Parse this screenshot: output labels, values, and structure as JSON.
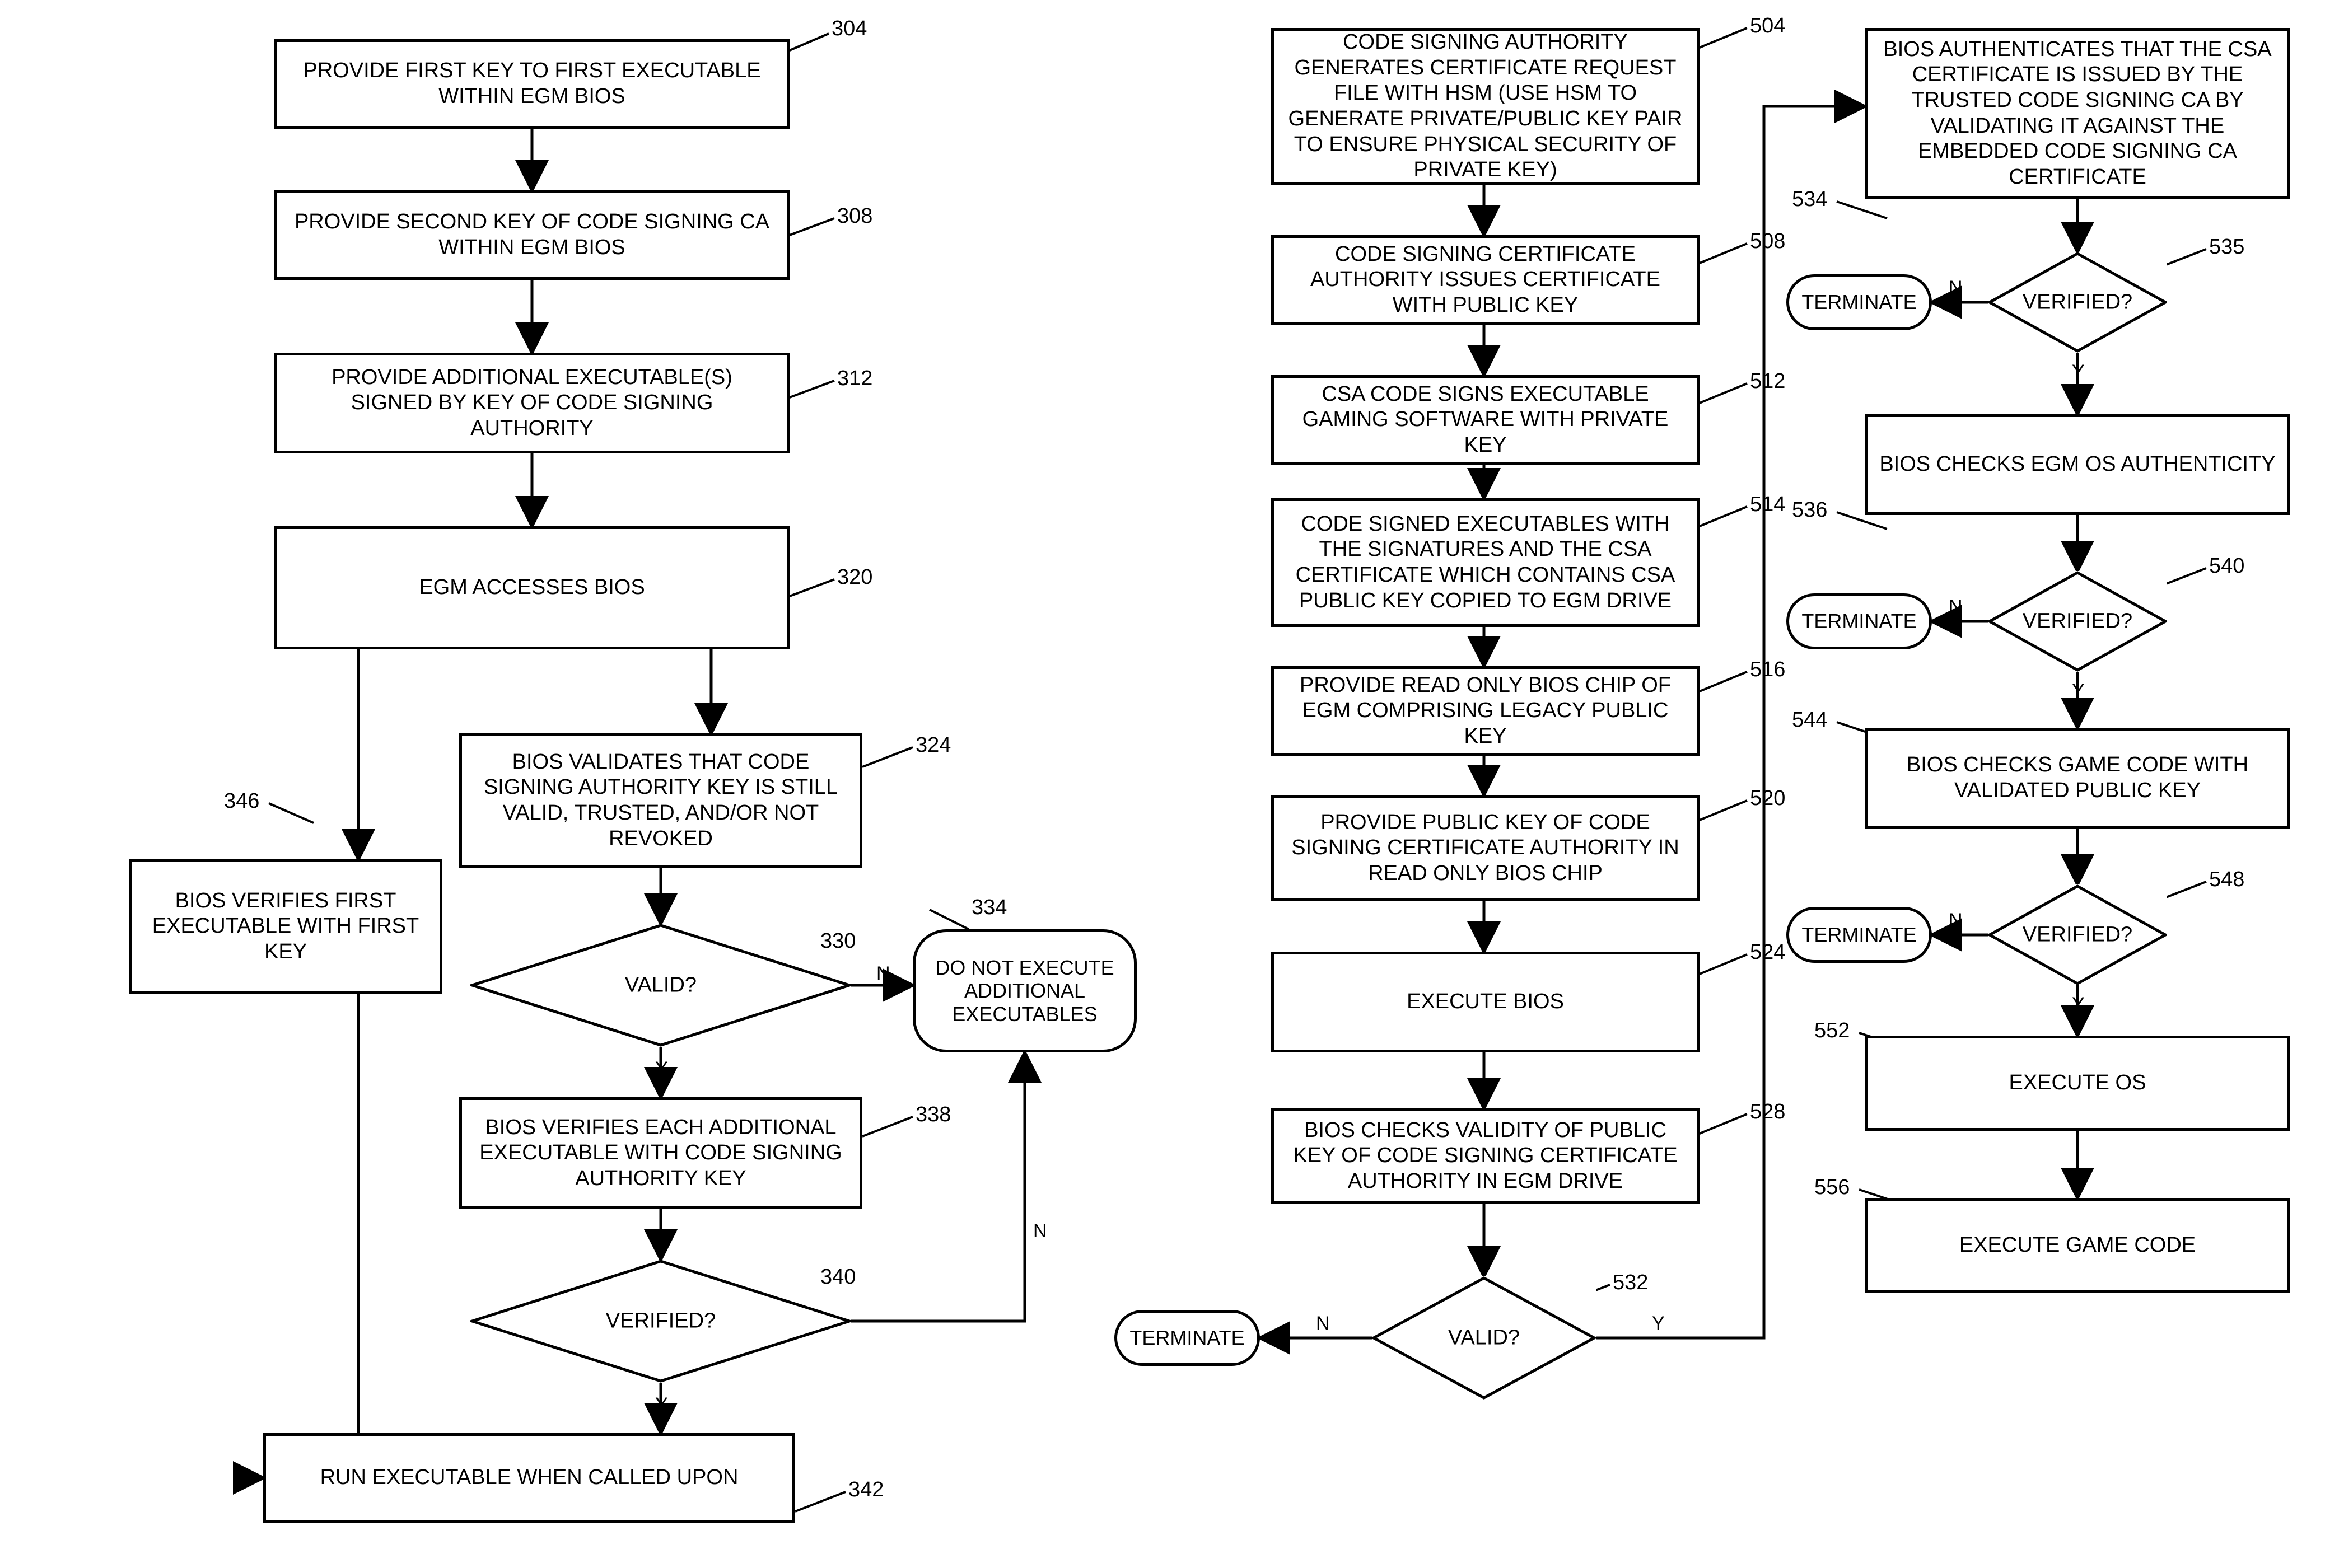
{
  "left": {
    "b304": "PROVIDE FIRST KEY TO FIRST EXECUTABLE WITHIN EGM BIOS",
    "b308": "PROVIDE SECOND KEY OF CODE SIGNING CA WITHIN EGM  BIOS",
    "b312": "PROVIDE ADDITIONAL EXECUTABLE(S) SIGNED BY KEY OF CODE SIGNING AUTHORITY",
    "b320": "EGM ACCESSES BIOS",
    "b324": "BIOS VALIDATES THAT CODE SIGNING AUTHORITY KEY IS STILL VALID, TRUSTED, AND/OR NOT REVOKED",
    "d330": "VALID?",
    "t334": "DO NOT EXECUTE ADDITIONAL EXECUTABLES",
    "b338": "BIOS VERIFIES EACH ADDITIONAL EXECUTABLE WITH CODE SIGNING AUTHORITY KEY",
    "d340": "VERIFIED?",
    "b342": "RUN EXECUTABLE WHEN CALLED UPON",
    "b346": "BIOS VERIFIES FIRST EXECUTABLE WITH FIRST KEY",
    "r304": "304",
    "r308": "308",
    "r312": "312",
    "r320": "320",
    "r324": "324",
    "r330": "330",
    "r334": "334",
    "r338": "338",
    "r340": "340",
    "r342": "342",
    "r346": "346"
  },
  "mid": {
    "b504": "CODE SIGNING AUTHORITY GENERATES CERTIFICATE REQUEST FILE WITH HSM (USE HSM TO GENERATE PRIVATE/PUBLIC KEY PAIR TO ENSURE PHYSICAL SECURITY OF PRIVATE KEY)",
    "b508": "CODE SIGNING CERTIFICATE AUTHORITY ISSUES CERTIFICATE WITH PUBLIC KEY",
    "b512": "CSA CODE SIGNS EXECUTABLE GAMING SOFTWARE WITH PRIVATE KEY",
    "b514": "CODE SIGNED EXECUTABLES WITH THE SIGNATURES AND THE CSA CERTIFICATE WHICH CONTAINS CSA PUBLIC KEY COPIED TO EGM DRIVE",
    "b516": "PROVIDE READ ONLY BIOS CHIP OF EGM COMPRISING LEGACY PUBLIC KEY",
    "b520": "PROVIDE PUBLIC KEY OF CODE SIGNING CERTIFICATE AUTHORITY IN READ ONLY BIOS CHIP",
    "b524": "EXECUTE BIOS",
    "b528": "BIOS CHECKS VALIDITY OF PUBLIC KEY OF CODE SIGNING CERTIFICATE AUTHORITY IN EGM DRIVE",
    "d532": "VALID?",
    "t532": "TERMINATE",
    "r504": "504",
    "r508": "508",
    "r512": "512",
    "r514": "514",
    "r516": "516",
    "r520": "520",
    "r524": "524",
    "r528": "528",
    "r532": "532"
  },
  "right": {
    "b534": "BIOS AUTHENTICATES THAT THE CSA CERTIFICATE IS ISSUED BY THE TRUSTED CODE SIGNING CA BY VALIDATING IT AGAINST THE EMBEDDED CODE SIGNING CA CERTIFICATE",
    "d535": "VERIFIED?",
    "t535": "TERMINATE",
    "b536": "BIOS CHECKS EGM OS AUTHENTICITY",
    "d540": "VERIFIED?",
    "t540": "TERMINATE",
    "b544": "BIOS CHECKS GAME CODE WITH VALIDATED PUBLIC KEY",
    "d548": "VERIFIED?",
    "t548": "TERMINATE",
    "b552": "EXECUTE OS",
    "b556": "EXECUTE GAME CODE",
    "r534": "534",
    "r535": "535",
    "r536": "536",
    "r540": "540",
    "r544": "544",
    "r548": "548",
    "r552": "552",
    "r556": "556"
  },
  "yn": {
    "Y": "Y",
    "N": "N"
  }
}
